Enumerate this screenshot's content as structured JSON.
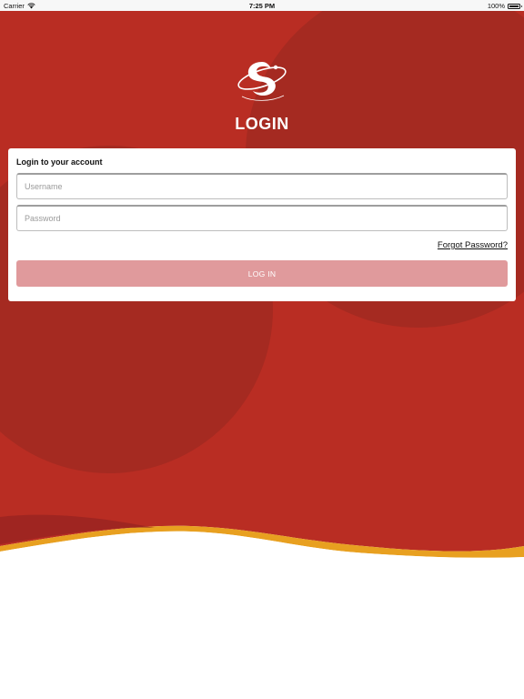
{
  "status_bar": {
    "carrier": "Carrier",
    "time": "7:25 PM",
    "battery": "100%",
    "battery_level": 1.0
  },
  "header": {
    "title": "LOGIN"
  },
  "login_card": {
    "heading": "Login to your account",
    "username_placeholder": "Username",
    "password_placeholder": "Password",
    "forgot_password_label": "Forgot Password?",
    "login_button_label": "LOG IN"
  },
  "colors": {
    "background_red": "#b92d23",
    "circle_dark_red": "#a52a21",
    "wave_orange": "#e8a020",
    "button_disabled": "#e09a9c",
    "card_background": "#ffffff"
  }
}
